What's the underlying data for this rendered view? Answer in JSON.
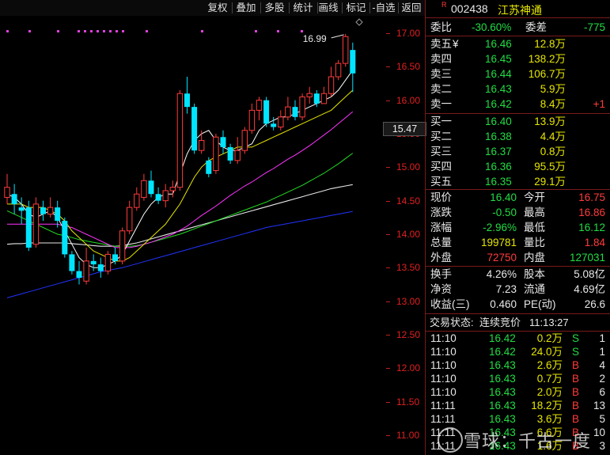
{
  "toolbar": {
    "buttons": [
      "复权",
      "叠加",
      "多股",
      "统计",
      "画线",
      "-自选",
      "返回"
    ]
  },
  "chart": {
    "y_ticks": [
      "17.00",
      "16.50",
      "16.00",
      "15.50",
      "15.00",
      "14.50",
      "14.00",
      "13.50",
      "13.00",
      "12.50",
      "12.00",
      "11.50",
      "11.00"
    ],
    "current_price_tag": "15.47",
    "high_label": "16.99",
    "candles": [
      {
        "o": 14.55,
        "c": 14.7,
        "h": 14.9,
        "l": 14.45
      },
      {
        "o": 14.6,
        "c": 14.45,
        "h": 14.75,
        "l": 14.3
      },
      {
        "o": 14.4,
        "c": 14.35,
        "h": 14.55,
        "l": 14.15
      },
      {
        "o": 14.4,
        "c": 13.8,
        "h": 14.5,
        "l": 13.75
      },
      {
        "o": 13.85,
        "c": 14.45,
        "h": 14.55,
        "l": 13.8
      },
      {
        "o": 14.4,
        "c": 14.3,
        "h": 14.5,
        "l": 14.2
      },
      {
        "o": 14.3,
        "c": 14.4,
        "h": 14.55,
        "l": 14.25
      },
      {
        "o": 14.4,
        "c": 14.2,
        "h": 14.5,
        "l": 14.1
      },
      {
        "o": 14.2,
        "c": 13.7,
        "h": 14.25,
        "l": 13.65
      },
      {
        "o": 13.7,
        "c": 13.45,
        "h": 13.75,
        "l": 13.4
      },
      {
        "o": 13.45,
        "c": 13.35,
        "h": 13.6,
        "l": 13.25
      },
      {
        "o": 13.3,
        "c": 13.6,
        "h": 13.8,
        "l": 13.25
      },
      {
        "o": 13.6,
        "c": 13.55,
        "h": 13.7,
        "l": 13.45
      },
      {
        "o": 13.55,
        "c": 13.45,
        "h": 13.65,
        "l": 13.35
      },
      {
        "o": 13.45,
        "c": 13.7,
        "h": 13.75,
        "l": 13.4
      },
      {
        "o": 13.7,
        "c": 13.6,
        "h": 13.8,
        "l": 13.55
      },
      {
        "o": 13.6,
        "c": 14.05,
        "h": 14.1,
        "l": 13.55
      },
      {
        "o": 14.05,
        "c": 14.4,
        "h": 14.5,
        "l": 14.0
      },
      {
        "o": 14.4,
        "c": 14.6,
        "h": 14.7,
        "l": 14.35
      },
      {
        "o": 14.55,
        "c": 14.8,
        "h": 14.9,
        "l": 14.5
      },
      {
        "o": 14.8,
        "c": 14.6,
        "h": 14.95,
        "l": 14.55
      },
      {
        "o": 14.6,
        "c": 14.5,
        "h": 14.7,
        "l": 14.45
      },
      {
        "o": 14.5,
        "c": 14.65,
        "h": 14.75,
        "l": 14.4
      },
      {
        "o": 14.65,
        "c": 14.7,
        "h": 14.8,
        "l": 14.55
      },
      {
        "o": 14.7,
        "c": 16.1,
        "h": 16.15,
        "l": 14.65
      },
      {
        "o": 16.1,
        "c": 15.9,
        "h": 16.35,
        "l": 15.8
      },
      {
        "o": 15.9,
        "c": 15.25,
        "h": 15.95,
        "l": 15.2
      },
      {
        "o": 15.25,
        "c": 15.4,
        "h": 15.55,
        "l": 15.2
      },
      {
        "o": 15.1,
        "c": 14.9,
        "h": 15.15,
        "l": 14.85
      },
      {
        "o": 14.95,
        "c": 15.45,
        "h": 15.5,
        "l": 14.9
      },
      {
        "o": 15.45,
        "c": 15.3,
        "h": 15.55,
        "l": 15.2
      },
      {
        "o": 15.3,
        "c": 15.1,
        "h": 15.35,
        "l": 15.05
      },
      {
        "o": 15.1,
        "c": 15.25,
        "h": 15.45,
        "l": 15.05
      },
      {
        "o": 15.25,
        "c": 15.55,
        "h": 15.6,
        "l": 15.2
      },
      {
        "o": 15.55,
        "c": 15.85,
        "h": 15.95,
        "l": 15.5
      },
      {
        "o": 15.85,
        "c": 16.0,
        "h": 16.05,
        "l": 15.7
      },
      {
        "o": 16.0,
        "c": 15.65,
        "h": 16.05,
        "l": 15.6
      },
      {
        "o": 15.65,
        "c": 15.6,
        "h": 15.75,
        "l": 15.55
      },
      {
        "o": 15.6,
        "c": 15.75,
        "h": 15.85,
        "l": 15.55
      },
      {
        "o": 15.75,
        "c": 15.9,
        "h": 16.05,
        "l": 15.7
      },
      {
        "o": 15.9,
        "c": 15.75,
        "h": 16.0,
        "l": 15.7
      },
      {
        "o": 15.75,
        "c": 16.05,
        "h": 16.1,
        "l": 15.7
      },
      {
        "o": 16.05,
        "c": 16.1,
        "h": 16.2,
        "l": 15.95
      },
      {
        "o": 16.1,
        "c": 15.95,
        "h": 16.15,
        "l": 15.9
      },
      {
        "o": 15.95,
        "c": 16.1,
        "h": 16.2,
        "l": 15.95
      },
      {
        "o": 16.1,
        "c": 16.35,
        "h": 16.5,
        "l": 16.05
      },
      {
        "o": 16.35,
        "c": 16.55,
        "h": 16.6,
        "l": 16.3
      },
      {
        "o": 16.55,
        "c": 16.95,
        "h": 16.99,
        "l": 16.5
      },
      {
        "o": 16.75,
        "c": 16.4,
        "h": 16.86,
        "l": 16.12
      }
    ],
    "ma5": [
      14.6,
      14.55,
      14.45,
      14.3,
      14.25,
      14.3,
      14.35,
      14.25,
      14.05,
      13.85,
      13.65,
      13.55,
      13.5,
      13.5,
      13.55,
      13.6,
      13.7,
      13.9,
      14.1,
      14.3,
      14.45,
      14.55,
      14.6,
      14.6,
      14.9,
      15.2,
      15.4,
      15.5,
      15.55,
      15.4,
      15.3,
      15.25,
      15.25,
      15.3,
      15.35,
      15.55,
      15.65,
      15.7,
      15.75,
      15.75,
      15.8,
      15.85,
      15.9,
      15.95,
      16.0,
      16.05,
      16.15,
      16.3,
      16.45
    ],
    "ma10": [
      14.45,
      14.45,
      14.45,
      14.4,
      14.4,
      14.4,
      14.35,
      14.3,
      14.2,
      14.05,
      13.95,
      13.85,
      13.75,
      13.7,
      13.65,
      13.6,
      13.6,
      13.65,
      13.75,
      13.85,
      13.95,
      14.05,
      14.15,
      14.3,
      14.45,
      14.65,
      14.85,
      15.0,
      15.1,
      15.15,
      15.2,
      15.25,
      15.3,
      15.3,
      15.3,
      15.35,
      15.4,
      15.45,
      15.5,
      15.55,
      15.6,
      15.65,
      15.7,
      15.75,
      15.8,
      15.85,
      15.95,
      16.05,
      16.15
    ],
    "ma20": [
      14.15,
      14.15,
      14.15,
      14.15,
      14.15,
      14.15,
      14.15,
      14.15,
      14.12,
      14.1,
      14.05,
      14.0,
      13.95,
      13.9,
      13.85,
      13.8,
      13.8,
      13.8,
      13.82,
      13.85,
      13.88,
      13.92,
      13.96,
      14.0,
      14.06,
      14.12,
      14.2,
      14.28,
      14.35,
      14.42,
      14.5,
      14.58,
      14.65,
      14.72,
      14.78,
      14.85,
      14.92,
      14.98,
      15.05,
      15.12,
      15.18,
      15.25,
      15.32,
      15.4,
      15.48,
      15.56,
      15.65,
      15.74,
      15.83
    ],
    "ma30": [
      14.35,
      14.3,
      14.25,
      14.2,
      14.15,
      14.1,
      14.05,
      14.0,
      13.98,
      13.95,
      13.92,
      13.9,
      13.88,
      13.86,
      13.84,
      13.82,
      13.82,
      13.82,
      13.83,
      13.85,
      13.88,
      13.91,
      13.94,
      13.97,
      14.0,
      14.04,
      14.08,
      14.12,
      14.16,
      14.2,
      14.24,
      14.28,
      14.32,
      14.36,
      14.4,
      14.44,
      14.48,
      14.53,
      14.58,
      14.63,
      14.68,
      14.73,
      14.79,
      14.85,
      14.91,
      14.98,
      15.05,
      15.13,
      15.21
    ],
    "ma60": [
      13.85,
      13.86,
      13.86,
      13.87,
      13.87,
      13.87,
      13.87,
      13.87,
      13.87,
      13.86,
      13.85,
      13.84,
      13.83,
      13.82,
      13.82,
      13.82,
      13.83,
      13.85,
      13.87,
      13.9,
      13.93,
      13.96,
      13.99,
      14.02,
      14.05,
      14.08,
      14.11,
      14.14,
      14.17,
      14.2,
      14.23,
      14.26,
      14.29,
      14.32,
      14.35,
      14.38,
      14.41,
      14.44,
      14.47,
      14.5,
      14.53,
      14.56,
      14.59,
      14.62,
      14.65,
      14.68,
      14.7,
      14.72,
      14.74
    ],
    "ma120": [
      13.05,
      13.08,
      13.11,
      13.14,
      13.17,
      13.2,
      13.23,
      13.26,
      13.29,
      13.32,
      13.35,
      13.38,
      13.41,
      13.44,
      13.46,
      13.48,
      13.5,
      13.53,
      13.56,
      13.59,
      13.62,
      13.65,
      13.68,
      13.71,
      13.74,
      13.77,
      13.8,
      13.83,
      13.86,
      13.89,
      13.92,
      13.95,
      13.98,
      14.01,
      14.04,
      14.07,
      14.1,
      14.12,
      14.14,
      14.16,
      14.18,
      14.2,
      14.22,
      14.24,
      14.26,
      14.28,
      14.3,
      14.32,
      14.34
    ],
    "colors": {
      "up": "#ff3b3b",
      "down": "#00e5ff",
      "ma5": "#ffffff",
      "ma10": "#e6e600",
      "ma20": "#ff33ff",
      "ma30": "#22dd22",
      "ma60": "#ffffff",
      "ma120": "#2233ff"
    }
  },
  "quote": {
    "badge": "R",
    "code": "002438",
    "name": "江苏神通",
    "webi_label": "委比",
    "webi_value": "-30.60%",
    "weicha_label": "委差",
    "weicha_value": "-775",
    "asks": [
      {
        "label": "卖五",
        "mark": "¥",
        "price": "16.46",
        "vol": "12.8万",
        "chg": ""
      },
      {
        "label": "卖四",
        "mark": "",
        "price": "16.45",
        "vol": "138.2万",
        "chg": ""
      },
      {
        "label": "卖三",
        "mark": "",
        "price": "16.44",
        "vol": "106.7万",
        "chg": ""
      },
      {
        "label": "卖二",
        "mark": "",
        "price": "16.43",
        "vol": "5.9万",
        "chg": ""
      },
      {
        "label": "卖一",
        "mark": "",
        "price": "16.42",
        "vol": "8.4万",
        "chg": "+1"
      }
    ],
    "bids": [
      {
        "label": "买一",
        "price": "16.40",
        "vol": "13.9万"
      },
      {
        "label": "买二",
        "price": "16.38",
        "vol": "4.4万"
      },
      {
        "label": "买三",
        "price": "16.37",
        "vol": "0.8万"
      },
      {
        "label": "买四",
        "price": "16.36",
        "vol": "95.5万"
      },
      {
        "label": "买五",
        "price": "16.35",
        "vol": "29.1万"
      }
    ],
    "stats1": [
      {
        "l1": "现价",
        "v1": "16.40",
        "c1": "green",
        "l2": "今开",
        "v2": "16.75",
        "c2": "red"
      },
      {
        "l1": "涨跌",
        "v1": "-0.50",
        "c1": "green",
        "l2": "最高",
        "v2": "16.86",
        "c2": "red"
      },
      {
        "l1": "涨幅",
        "v1": "-2.96%",
        "c1": "green",
        "l2": "最低",
        "v2": "16.12",
        "c2": "green"
      },
      {
        "l1": "总量",
        "v1": "199781",
        "c1": "yellow",
        "l2": "量比",
        "v2": "1.84",
        "c2": "red"
      },
      {
        "l1": "外盘",
        "v1": "72750",
        "c1": "red",
        "l2": "内盘",
        "v2": "127031",
        "c2": "green"
      }
    ],
    "stats2": [
      {
        "l1": "换手",
        "v1": "4.26%",
        "l2": "股本",
        "v2": "5.08亿"
      },
      {
        "l1": "净资",
        "v1": "7.23",
        "l2": "流通",
        "v2": "4.69亿"
      },
      {
        "l1": "收益(三)",
        "v1": "0.460",
        "l2": "PE(动)",
        "v2": "26.6"
      }
    ],
    "status_label": "交易状态:",
    "status_value": "连续竞价",
    "status_time": "11:13:27",
    "ticks": [
      {
        "time": "11:10",
        "price": "16.42",
        "vol": "0.2万",
        "side": "S",
        "n": "1"
      },
      {
        "time": "11:10",
        "price": "16.42",
        "vol": "24.0万",
        "side": "S",
        "n": "1"
      },
      {
        "time": "11:10",
        "price": "16.43",
        "vol": "2.6万",
        "side": "B",
        "n": "4"
      },
      {
        "time": "11:10",
        "price": "16.43",
        "vol": "0.7万",
        "side": "B",
        "n": "2"
      },
      {
        "time": "11:10",
        "price": "16.43",
        "vol": "2.0万",
        "side": "B",
        "n": "6"
      },
      {
        "time": "11:11",
        "price": "16.43",
        "vol": "18.2万",
        "side": "B",
        "n": "13"
      },
      {
        "time": "11:11",
        "price": "16.43",
        "vol": "3.6万",
        "side": "B",
        "n": "5"
      },
      {
        "time": "11:11",
        "price": "16.43",
        "vol": "6.6万",
        "side": "B",
        "n": "10"
      },
      {
        "time": "11:11",
        "price": "16.43",
        "vol": "1.6万",
        "side": "B",
        "n": "3"
      }
    ]
  },
  "watermark": "雪球：千古一度"
}
